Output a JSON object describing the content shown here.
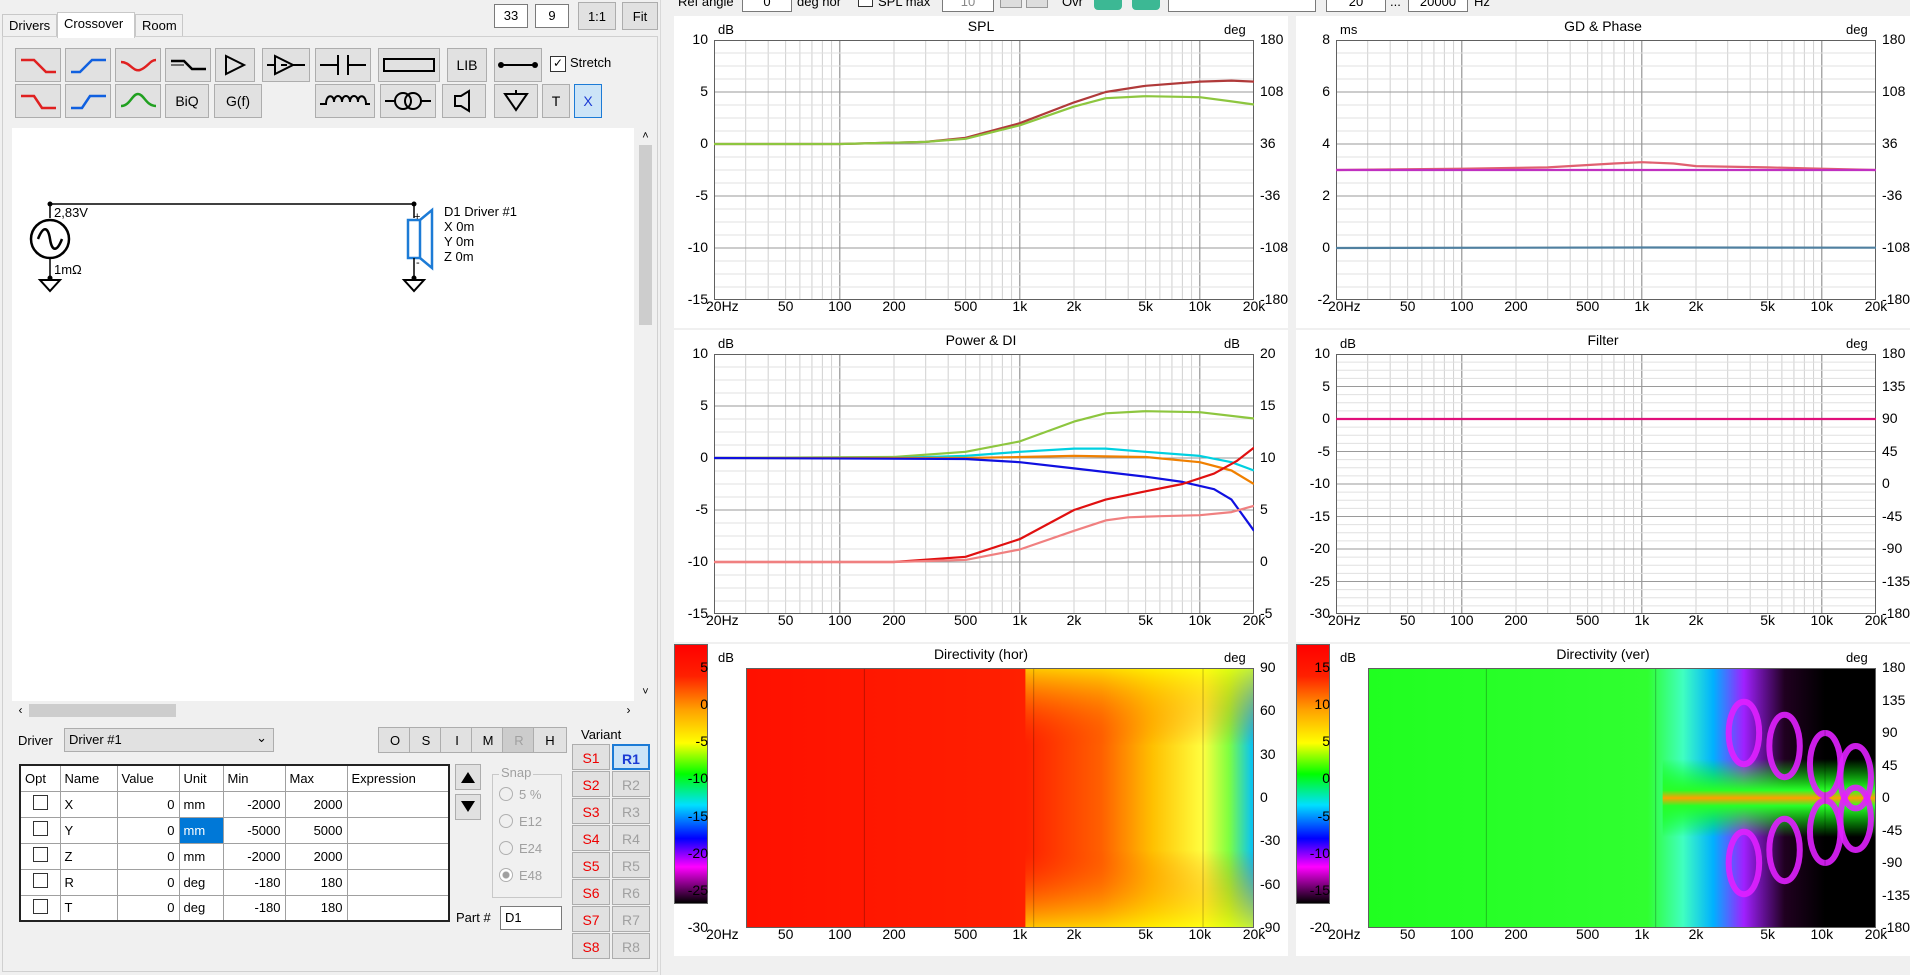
{
  "topbar": {
    "ref_angle_label": "Ref angle",
    "ref_angle_value": "0",
    "deg_hor_label": "deg hor",
    "spl_max_label": "SPL max",
    "spl_max_value": "10",
    "ovr_label": "Ovr",
    "freq_min": "20",
    "freq_sep": "...",
    "freq_max": "20000",
    "freq_unit": "Hz",
    "zoom_a": "33",
    "zoom_b": "9",
    "btn_1to1": "1:1",
    "btn_fit": "Fit"
  },
  "tabs": [
    {
      "label": "Drivers"
    },
    {
      "label": "Crossover"
    },
    {
      "label": "Room"
    }
  ],
  "toolbar": {
    "lib_label": "LIB",
    "biq_label": "BiQ",
    "gf_label": "G(f)",
    "stretch_label": "Stretch",
    "t_label": "T",
    "x_label": "X"
  },
  "schematic": {
    "voltage": "2,83V",
    "resistance": "1mΩ",
    "driver_name": "D1 Driver #1",
    "x": "X 0m",
    "y": "Y 0m",
    "z": "Z 0m",
    "plus": "+",
    "minus": "-"
  },
  "driver_select": {
    "label": "Driver",
    "value": "Driver #1"
  },
  "setting_buttons": [
    {
      "label": "O",
      "enabled": true
    },
    {
      "label": "S",
      "enabled": true
    },
    {
      "label": "I",
      "enabled": true
    },
    {
      "label": "M",
      "enabled": true
    },
    {
      "label": "R",
      "enabled": false
    },
    {
      "label": "H",
      "enabled": true
    }
  ],
  "params": {
    "headers": [
      "Opt",
      "Name",
      "Value",
      "Unit",
      "Min",
      "Max",
      "Expression"
    ],
    "rows": [
      {
        "name": "X",
        "value": "0",
        "unit": "mm",
        "min": "-2000",
        "max": "2000",
        "expr": ""
      },
      {
        "name": "Y",
        "value": "0",
        "unit": "mm",
        "min": "-5000",
        "max": "5000",
        "expr": ""
      },
      {
        "name": "Z",
        "value": "0",
        "unit": "mm",
        "min": "-2000",
        "max": "2000",
        "expr": ""
      },
      {
        "name": "R",
        "value": "0",
        "unit": "deg",
        "min": "-180",
        "max": "180",
        "expr": ""
      },
      {
        "name": "T",
        "value": "0",
        "unit": "deg",
        "min": "-180",
        "max": "180",
        "expr": ""
      }
    ]
  },
  "snap": {
    "label": "Snap",
    "options": [
      "5 %",
      "E12",
      "E24",
      "E48"
    ],
    "selected": "E48"
  },
  "part": {
    "label": "Part #",
    "value": "D1"
  },
  "variant": {
    "label": "Variant",
    "s": [
      "S1",
      "S2",
      "S3",
      "S4",
      "S5",
      "S6",
      "S7",
      "S8"
    ],
    "r": [
      "R1",
      "R2",
      "R3",
      "R4",
      "R5",
      "R6",
      "R7",
      "R8"
    ],
    "selected": "R1"
  },
  "freq_ticks": [
    "20Hz",
    "50",
    "100",
    "200",
    "500",
    "1k",
    "2k",
    "5k",
    "10k",
    "20k"
  ],
  "charts": {
    "spl": {
      "title": "SPL",
      "lunit": "dB",
      "runit": "deg",
      "lticks": [
        "10",
        "5",
        "0",
        "-5",
        "-10",
        "-15"
      ],
      "rticks": [
        "180",
        "108",
        "36",
        "-36",
        "-108",
        "-180"
      ]
    },
    "gd": {
      "title": "GD & Phase",
      "lunit": "ms",
      "runit": "deg",
      "lticks": [
        "8",
        "6",
        "4",
        "2",
        "0",
        "-2"
      ],
      "rticks": [
        "180",
        "108",
        "36",
        "-36",
        "-108",
        "-180"
      ]
    },
    "power": {
      "title": "Power & DI",
      "lunit": "dB",
      "runit": "dB",
      "lticks": [
        "10",
        "5",
        "0",
        "-5",
        "-10",
        "-15"
      ],
      "rticks": [
        "20",
        "15",
        "10",
        "5",
        "0",
        "-5"
      ]
    },
    "filter": {
      "title": "Filter",
      "lunit": "dB",
      "runit": "deg",
      "lticks": [
        "10",
        "5",
        "0",
        "-5",
        "-10",
        "-15",
        "-20",
        "-25",
        "-30"
      ],
      "rticks": [
        "180",
        "135",
        "90",
        "45",
        "0",
        "-45",
        "-90",
        "-135",
        "-180"
      ]
    },
    "dir_hor": {
      "title": "Directivity (hor)",
      "lunit": "dB",
      "runit": "deg",
      "scale": [
        "5",
        "0",
        "-5",
        "-10",
        "-15",
        "-20",
        "-25",
        "-30"
      ],
      "rticks": [
        "90",
        "60",
        "30",
        "0",
        "-30",
        "-60",
        "-90"
      ]
    },
    "dir_ver": {
      "title": "Directivity (ver)",
      "lunit": "dB",
      "runit": "deg",
      "scale": [
        "15",
        "10",
        "5",
        "0",
        "-5",
        "-10",
        "-15",
        "-20"
      ],
      "rticks": [
        "180",
        "135",
        "90",
        "45",
        "0",
        "-45",
        "-90",
        "-135",
        "-180"
      ]
    }
  },
  "chart_data": [
    {
      "type": "line",
      "title": "SPL",
      "ylabel": "dB",
      "ylim": [
        -15,
        10
      ],
      "xscale": "log",
      "xlim": [
        20,
        20000
      ],
      "series": [
        {
          "color": "#b03a3a",
          "x": [
            20,
            100,
            300,
            500,
            1000,
            2000,
            3000,
            5000,
            10000,
            15000,
            20000
          ],
          "y": [
            0,
            0,
            0.2,
            0.6,
            2.0,
            4.0,
            5.0,
            5.6,
            6.0,
            6.1,
            6.0
          ]
        },
        {
          "color": "#8dc63f",
          "x": [
            20,
            100,
            300,
            500,
            1000,
            2000,
            3000,
            5000,
            10000,
            15000,
            20000
          ],
          "y": [
            0,
            0,
            0.2,
            0.5,
            1.8,
            3.6,
            4.4,
            4.6,
            4.5,
            4.1,
            3.8
          ]
        }
      ]
    },
    {
      "type": "line",
      "title": "GD & Phase",
      "ylabel": "ms",
      "ylim": [
        -2,
        8
      ],
      "xscale": "log",
      "xlim": [
        20,
        20000
      ],
      "series": [
        {
          "color": "#e06070",
          "x": [
            20,
            100,
            300,
            700,
            1000,
            1500,
            2000,
            5000,
            10000,
            20000
          ],
          "y": [
            3,
            3.05,
            3.1,
            3.25,
            3.3,
            3.25,
            3.15,
            3.1,
            3.05,
            3
          ]
        },
        {
          "color": "#c030c0",
          "x": [
            20,
            20000
          ],
          "y": [
            3,
            3
          ]
        },
        {
          "color": "#5080a0",
          "x": [
            20,
            1000,
            20000
          ],
          "y": [
            0,
            0.02,
            0.01
          ]
        }
      ]
    },
    {
      "type": "line",
      "title": "Power & DI",
      "ylabel": "dB",
      "ylim": [
        -15,
        10
      ],
      "xscale": "log",
      "xlim": [
        20,
        20000
      ],
      "series": [
        {
          "color": "#8dc63f",
          "x": [
            20,
            200,
            500,
            1000,
            2000,
            3000,
            5000,
            10000,
            20000
          ],
          "y": [
            0,
            0.1,
            0.6,
            1.6,
            3.5,
            4.3,
            4.5,
            4.4,
            3.8
          ]
        },
        {
          "color": "#00d0e0",
          "x": [
            20,
            200,
            500,
            1000,
            2000,
            3000,
            5000,
            10000,
            15000,
            20000
          ],
          "y": [
            0,
            0,
            0.2,
            0.6,
            0.9,
            0.9,
            0.6,
            0.2,
            -0.4,
            -1.2
          ]
        },
        {
          "color": "#f08000",
          "x": [
            20,
            500,
            1000,
            2000,
            5000,
            10000,
            15000,
            20000
          ],
          "y": [
            0,
            0,
            0.1,
            0.2,
            0.1,
            -0.4,
            -1.2,
            -2.5
          ]
        },
        {
          "color": "#1010e0",
          "x": [
            20,
            500,
            1000,
            2000,
            5000,
            8000,
            12000,
            15000,
            20000
          ],
          "y": [
            0,
            -0.1,
            -0.4,
            -1.0,
            -1.8,
            -2.3,
            -3.0,
            -4.0,
            -7.0
          ]
        },
        {
          "color": "#e01010",
          "x": [
            20,
            200,
            500,
            1000,
            2000,
            3000,
            5000,
            8000,
            12000,
            16000,
            20000
          ],
          "y": [
            -10,
            -10,
            -9.5,
            -7.8,
            -5.0,
            -4.0,
            -3.2,
            -2.5,
            -1.5,
            -0.3,
            1.0
          ]
        },
        {
          "color": "#f08080",
          "x": [
            20,
            200,
            500,
            1000,
            2000,
            3000,
            4000,
            6000,
            10000,
            15000,
            20000
          ],
          "y": [
            -10,
            -10,
            -9.8,
            -8.8,
            -7.0,
            -6.0,
            -5.7,
            -5.6,
            -5.5,
            -5.2,
            -4.6
          ]
        }
      ]
    },
    {
      "type": "line",
      "title": "Filter",
      "ylabel": "dB",
      "ylim": [
        -30,
        10
      ],
      "xscale": "log",
      "xlim": [
        20,
        20000
      ],
      "series": [
        {
          "color": "#e0107a",
          "x": [
            20,
            20000
          ],
          "y": [
            0,
            0
          ]
        }
      ]
    },
    {
      "type": "heatmap",
      "title": "Directivity (hor)",
      "ylabel": "deg",
      "ylim": [
        -90,
        90
      ],
      "xscale": "log",
      "xlim": [
        20,
        20000
      ],
      "color_scale": [
        5,
        -30
      ]
    },
    {
      "type": "heatmap",
      "title": "Directivity (ver)",
      "ylabel": "deg",
      "ylim": [
        -180,
        180
      ],
      "xscale": "log",
      "xlim": [
        20,
        20000
      ],
      "color_scale": [
        15,
        -20
      ]
    }
  ]
}
